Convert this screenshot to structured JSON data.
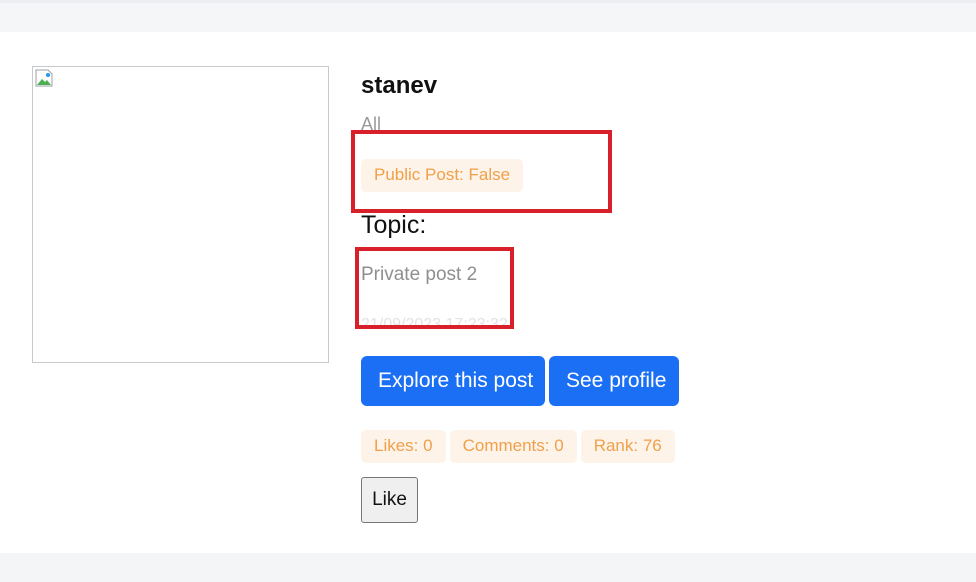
{
  "post": {
    "username": "stanev",
    "category": "All",
    "public_badge": "Public Post: False",
    "topic_label": "Topic:",
    "topic_value": "Private post 2",
    "timestamp": "21/09/2023 17:23:32"
  },
  "actions": {
    "explore_label": "Explore this post",
    "profile_label": "See profile",
    "like_label": "Like"
  },
  "stats": {
    "likes": "Likes: 0",
    "comments": "Comments: 0",
    "rank": "Rank: 76"
  },
  "image": {
    "icon": "broken-image-icon"
  },
  "colors": {
    "accent": "#1a6ff5",
    "badge_bg": "#fdf3e9",
    "badge_text": "#f0a04b",
    "highlight": "#d8202b"
  }
}
